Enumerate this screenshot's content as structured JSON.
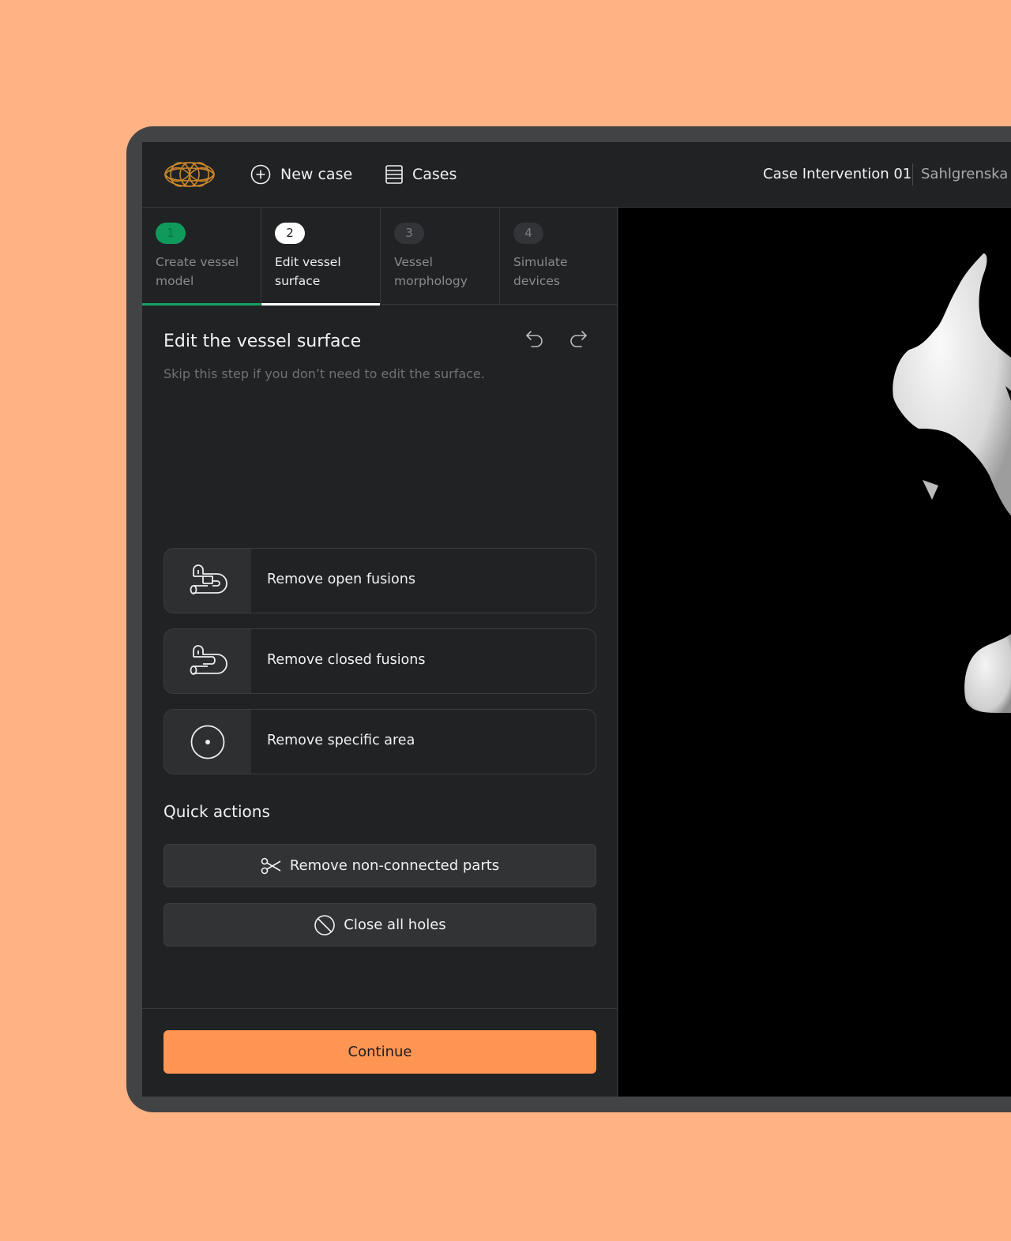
{
  "colors": {
    "background": "#ffb284",
    "accent_orange": "#ff9553",
    "step_done_green": "#13a264",
    "panel_bg": "#212224"
  },
  "header": {
    "logo_icon": "mesh-logo",
    "new_case_icon": "plus-circle-icon",
    "new_case_label": "New case",
    "cases_icon": "list-icon",
    "cases_label": "Cases",
    "case_title": "Case Intervention 01",
    "hospital": "Sahlgrenska"
  },
  "steps": [
    {
      "number": "1",
      "label": "Create vessel model",
      "state": "done"
    },
    {
      "number": "2",
      "label": "Edit vessel surface",
      "state": "active"
    },
    {
      "number": "3",
      "label": "Vessel morphology",
      "state": "inactive"
    },
    {
      "number": "4",
      "label": "Simulate devices",
      "state": "inactive"
    }
  ],
  "section": {
    "title": "Edit the vessel surface",
    "subtitle": "Skip this step if you don’t need to edit the surface.",
    "undo_icon": "undo-icon",
    "redo_icon": "redo-icon"
  },
  "tools": [
    {
      "label": "Remove open fusions",
      "icon": "open-fusion-icon"
    },
    {
      "label": "Remove closed fusions",
      "icon": "closed-fusion-icon"
    },
    {
      "label": "Remove specific area",
      "icon": "target-icon"
    }
  ],
  "quick_actions": {
    "title": "Quick actions",
    "items": [
      {
        "label": "Remove non-connected parts",
        "icon": "scissors-icon"
      },
      {
        "label": "Close all holes",
        "icon": "prohibited-icon"
      }
    ]
  },
  "footer": {
    "continue_label": "Continue"
  }
}
